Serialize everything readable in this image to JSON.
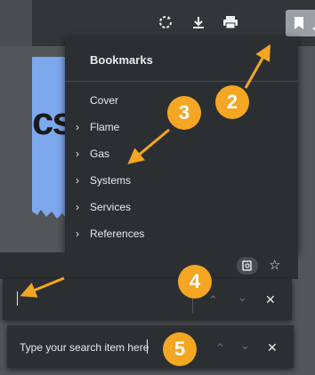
{
  "toolbar": {
    "icons": [
      "rotate-icon",
      "download-icon",
      "print-icon",
      "bookmark-icon",
      "chevron-down-icon"
    ]
  },
  "page_preview": {
    "text": "cs"
  },
  "bookmarks_panel": {
    "title": "Bookmarks",
    "items": [
      {
        "label": "Cover",
        "expandable": false
      },
      {
        "label": "Flame",
        "expandable": true
      },
      {
        "label": "Gas",
        "expandable": true
      },
      {
        "label": "Systems",
        "expandable": true
      },
      {
        "label": "Services",
        "expandable": true
      },
      {
        "label": "References",
        "expandable": true
      }
    ]
  },
  "find_bar_1": {
    "value": "",
    "close": "✕"
  },
  "find_bar_2": {
    "value": "Type your search item here",
    "close": "✕"
  },
  "badges": [
    "2",
    "3",
    "4",
    "5"
  ],
  "colors": {
    "accent": "#f5a623",
    "panel": "#2c2f32",
    "toolbar": "#323639"
  }
}
